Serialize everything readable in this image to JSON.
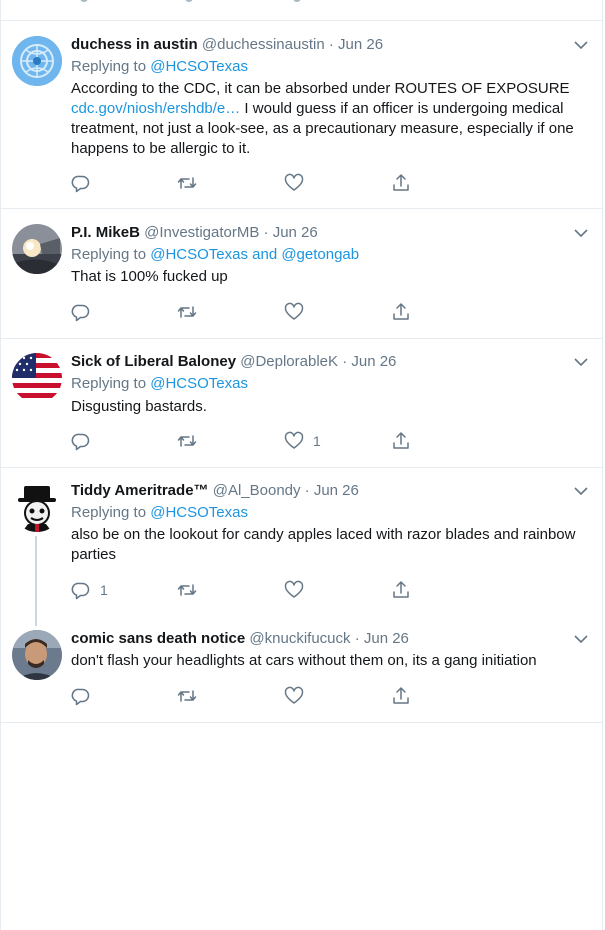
{
  "tweets": [
    {
      "name": "duchess in austin",
      "handle": "@duchessinaustin",
      "date": "· Jun 26",
      "replying_label": "Replying to",
      "replying_to": "@HCSOTexas",
      "text_pre": "According to the CDC, it can be absorbed under ROUTES OF EXPOSURE ",
      "text_link": "cdc.gov/niosh/ershdb/e…",
      "text_post": " I would guess if an officer is undergoing medical treatment, not just a look-see, as a precautionary measure, especially if one happens to be allergic to it.",
      "avatar": "globe-logo-avatar",
      "reply_count": "",
      "retweet_count": "",
      "like_count": ""
    },
    {
      "name": "P.I. MikeB",
      "handle": "@InvestigatorMB",
      "date": "· Jun 26",
      "replying_label": "Replying to",
      "replying_to": "@HCSOTexas and @getongab",
      "text": "That is 100% fucked up",
      "avatar": "photo-avatar",
      "reply_count": "",
      "retweet_count": "",
      "like_count": ""
    },
    {
      "name": "Sick of Liberal Baloney",
      "handle": "@DeplorableK",
      "date": "· Jun 26",
      "replying_label": "Replying to",
      "replying_to": "@HCSOTexas",
      "text": "Disgusting bastards.",
      "avatar": "us-flag-avatar",
      "reply_count": "",
      "retweet_count": "",
      "like_count": "1"
    },
    {
      "name": "Tiddy Ameritrade™",
      "handle": "@Al_Boondy",
      "date": "· Jun 26",
      "replying_label": "Replying to",
      "replying_to": "@HCSOTexas",
      "text": "also be on the lookout for candy apples laced with razor blades and rainbow parties",
      "avatar": "hat-character-avatar",
      "reply_count": "1",
      "retweet_count": "",
      "like_count": ""
    },
    {
      "name": "comic sans death notice",
      "handle": "@knuckifucuck",
      "date": "· Jun 26",
      "text": "don't flash your headlights at cars without them on, its a gang initiation",
      "avatar": "man-photo-avatar",
      "reply_count": "",
      "retweet_count": "",
      "like_count": ""
    }
  ],
  "icons": {
    "reply": "reply-icon",
    "retweet": "retweet-icon",
    "like": "heart-icon",
    "share": "share-icon",
    "more": "chevron-down-icon"
  },
  "colors": {
    "link": "#1b95e0",
    "secondary_text": "#657786",
    "divider": "#e6ecf0",
    "thread_line": "#ccd6dd"
  }
}
